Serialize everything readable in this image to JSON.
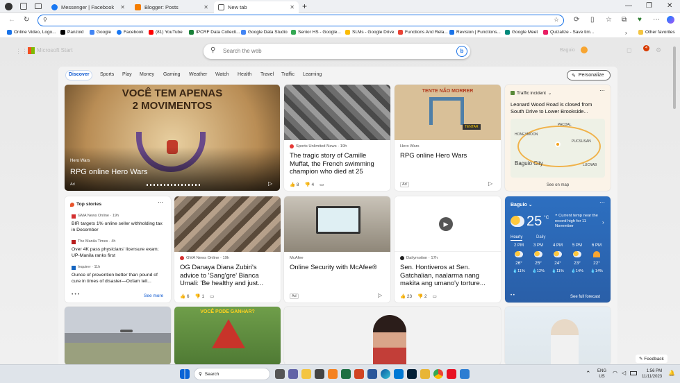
{
  "tabs": [
    {
      "title": "Messenger | Facebook",
      "color": "#1877f2"
    },
    {
      "title": "Blogger: Posts",
      "color": "#f57d00"
    },
    {
      "title": "New tab",
      "color": "#666"
    }
  ],
  "bookmarks": [
    {
      "label": "Online Video, Logo...",
      "color": "#1a73e8"
    },
    {
      "label": "Panzoid",
      "color": "#000"
    },
    {
      "label": "Google",
      "color": "#4285f4"
    },
    {
      "label": "Facebook",
      "color": "#1877f2"
    },
    {
      "label": "(81) YouTube",
      "color": "#f00"
    },
    {
      "label": "IPCRF Data Collecti...",
      "color": "#188038"
    },
    {
      "label": "Google Data Studio",
      "color": "#4285f4"
    },
    {
      "label": "Senior HS - Google...",
      "color": "#34a853"
    },
    {
      "label": "SLMs - Google Drive",
      "color": "#fbbc04"
    },
    {
      "label": "Functions And Rela...",
      "color": "#ea4335"
    },
    {
      "label": "Revision | Functions...",
      "color": "#1a73e8"
    },
    {
      "label": "Google Meet",
      "color": "#00897b"
    },
    {
      "label": "Quizalize - Save tim...",
      "color": "#e91e63"
    }
  ],
  "other_favorites": "Other favorites",
  "search_placeholder": "Search the web",
  "brand": "Microsoft Start",
  "location": "Baguio",
  "notif_count": "4",
  "nav_tabs": [
    "Discover",
    "Sports",
    "Play",
    "Money",
    "Gaming",
    "Weather",
    "Watch",
    "Health",
    "Travel",
    "Traffic",
    "Learning"
  ],
  "personalize": "Personalize",
  "hero": {
    "game_title": "VOCÊ TEM APENAS",
    "game_title2": "2 MOVIMENTOS",
    "source": "Hero Wars",
    "title": "RPG online Hero Wars",
    "ad": "Ad"
  },
  "card_camille": {
    "source": "Sports Unlimited News · 19h",
    "title": "The tragic story of Camille Muffat, the French swimming champion who died at 25",
    "likes": "8",
    "dislikes": "4"
  },
  "card_herowars2": {
    "banner": "TENTE NÃO MORRER",
    "button": "TENTAR",
    "source": "Hero Wars",
    "title": "RPG online Hero Wars",
    "ad": "Ad"
  },
  "traffic": {
    "label": "Traffic incident",
    "title": "Leonard Wood Road is closed from South Drive to Lower Brookside...",
    "see_map": "See on map",
    "map_labels": [
      "PACDAL",
      "HONEYMOON",
      "PUCSUSAN",
      "LUCNAB",
      "Baguio City"
    ]
  },
  "top_stories": {
    "header": "Top stories",
    "items": [
      {
        "source": "GMA News Online · 19h",
        "title": "BIR targets 1% online seller withholding tax in December",
        "color": "#d32f2f"
      },
      {
        "source": "The Manila Times · 4h",
        "title": "Over 4K pass physicians' licensure exam; UP-Manila ranks first",
        "color": "#b71c1c"
      },
      {
        "source": "Inquirer · 11h",
        "title": "Ounce of prevention better than pound of cure in times of disaster—Oxfam tell...",
        "color": "#1565c0"
      }
    ],
    "see_more": "See more"
  },
  "card_danaya": {
    "source": "GMA News Online · 19h",
    "title": "OG Danaya Diana Zubiri's advice to 'Sang'gre' Bianca Umali: 'Be healthy and just...",
    "likes": "6",
    "dislikes": "1"
  },
  "card_mcafee": {
    "source": "McAfee",
    "title": "Online Security with McAfee®",
    "ad": "Ad"
  },
  "card_hontiveros": {
    "source": "Dailymotion · 17h",
    "title": "Sen. Hontiveros at Sen. Gatchalian, naalarma nang makita ang umano'y torture...",
    "likes": "23",
    "dislikes": "2"
  },
  "weather": {
    "city": "Baguio",
    "temp": "25",
    "unit": "°C",
    "note": "Current temp near the record high for 11 November",
    "tabs": [
      "Hourly",
      "Daily"
    ],
    "hours": [
      {
        "time": "2 PM",
        "temp": "26°",
        "rain": "11%"
      },
      {
        "time": "3 PM",
        "temp": "25°",
        "rain": "12%"
      },
      {
        "time": "4 PM",
        "temp": "24°",
        "rain": "11%"
      },
      {
        "time": "5 PM",
        "temp": "23°",
        "rain": "14%"
      },
      {
        "time": "6 PM",
        "temp": "22°",
        "rain": "14%"
      }
    ],
    "full_forecast": "See full forecast"
  },
  "bottom_game": "VOCÊ PODE GANHAR?",
  "feedback": "Feedback",
  "taskbar": {
    "search": "Search",
    "lang": "ENG",
    "region": "US",
    "time": "1:56 PM",
    "date": "11/11/2023"
  }
}
